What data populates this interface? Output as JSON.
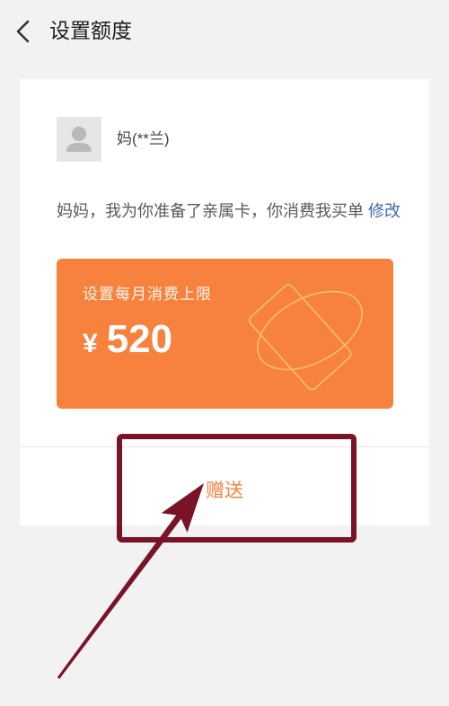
{
  "header": {
    "back_icon": "chevron-left-icon",
    "title": "设置额度"
  },
  "recipient": {
    "avatar_icon": "default-person-avatar-icon",
    "name": "妈(**兰)"
  },
  "message": {
    "text": "妈妈，我为你准备了亲属卡，你消费我买单",
    "edit_label": "修改"
  },
  "limit_card": {
    "label": "设置每月消费上限",
    "currency": "¥",
    "amount": "520",
    "decoration_icon": "card-orbit-icon"
  },
  "gift_button": {
    "label": "赠送"
  },
  "colors": {
    "background": "#F2F2F2",
    "card": "#FFFFFF",
    "accent_orange": "#F7823D",
    "link_blue": "#3F6AB0",
    "annotation_red": "#7A1228"
  }
}
